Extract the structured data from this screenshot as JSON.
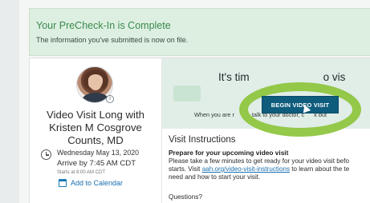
{
  "banner": {
    "title": "Your PreCheck-In is Complete",
    "message": "The information you've submitted is now on file."
  },
  "appointment": {
    "title": "Video Visit Long with Kristen M Cosgrove Counts, MD",
    "date": "Wednesday May 13, 2020",
    "arrive": "Arrive by 7:45 AM CDT",
    "starts": "Starts at 8:00 AM CDT",
    "add_to_calendar": "Add to Calendar"
  },
  "hero": {
    "heading": "It's tim",
    "heading_tail": "o vis",
    "subtext_left": "When you are r",
    "subtext_right": "talk to your doctor, c",
    "subtext_end": "k but",
    "begin_button": "BEGIN VIDEO VISIT"
  },
  "instructions": {
    "heading": "Visit Instructions",
    "prepare_heading": "Prepare for your upcoming video visit",
    "body_line1": "Please take a few minutes to get ready for your video visit befo",
    "body_line2_a": "starts. Visit ",
    "body_link": "aah.org/video-visit-instructions",
    "body_line2_b": " to learn about the te",
    "body_line3": "need and how to start your visit.",
    "questions": "Questions?"
  },
  "colors": {
    "banner_bg": "#dcefe1",
    "banner_title": "#3c8a4d",
    "button_bg": "#0f5c7d",
    "highlight_ring": "#8ec63f",
    "link": "#1b6fae"
  }
}
